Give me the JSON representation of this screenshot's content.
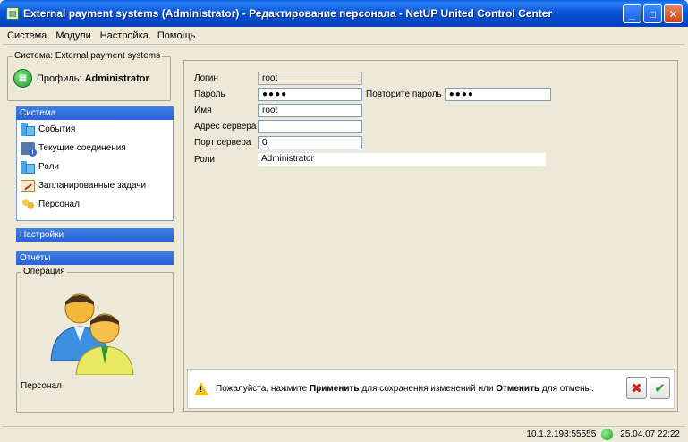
{
  "window": {
    "title": "External payment systems (Administrator) - Редактирование персонала - NetUP United Control Center",
    "minimize": "_",
    "maximize": "□",
    "close": "✕"
  },
  "menu": [
    "Система",
    "Модули",
    "Настройка",
    "Помощь"
  ],
  "sidebar": {
    "system_legend": "Система: External payment systems",
    "profile_label": "Профиль:",
    "profile_value": "Administrator",
    "section_system": "Система",
    "items": [
      {
        "label": "События",
        "icon": "events-icon"
      },
      {
        "label": "Текущие соединения",
        "icon": "connections-icon"
      },
      {
        "label": "Роли",
        "icon": "roles-icon"
      },
      {
        "label": "Запланированные задачи",
        "icon": "scheduled-tasks-icon"
      },
      {
        "label": "Персонал",
        "icon": "staff-icon"
      }
    ],
    "section_settings": "Настройки",
    "section_reports": "Отчеты",
    "operation_legend": "Операция",
    "operation_caption": "Персонал"
  },
  "form": {
    "login_label": "Логин",
    "login_value": "root",
    "password_label": "Пароль",
    "password_value": "●●●●",
    "repeat_password_label": "Повторите пароль",
    "repeat_password_value": "●●●●",
    "name_label": "Имя",
    "name_value": "root",
    "server_address_label": "Адрес сервера",
    "server_address_value": "",
    "server_port_label": "Порт сервера",
    "server_port_value": "0",
    "roles_label": "Роли",
    "roles_value": "Administrator"
  },
  "notice": {
    "prefix": "Пожалуйста, нажмите ",
    "apply": "Применить",
    "middle": " для сохранения изменений или ",
    "cancel": "Отменить",
    "suffix": " для отмены.",
    "cancel_button_glyph": "✖",
    "ok_button_glyph": "✔"
  },
  "status": {
    "address": "10.1.2.198:55555",
    "datetime": "25.04.07 22:22"
  }
}
